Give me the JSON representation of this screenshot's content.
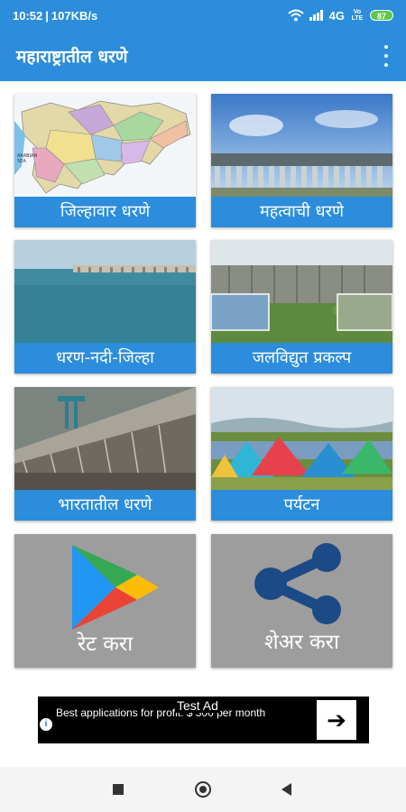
{
  "status_bar": {
    "time": "10:52",
    "speed": "107KB/s",
    "network": "4G",
    "lte": "Vo LTE",
    "battery": "87"
  },
  "app_bar": {
    "title": "महाराष्ट्रातील धरणे",
    "menu_icon": "more-vert-icon"
  },
  "tiles": [
    {
      "label": "जिल्हावार धरणे",
      "image": "maharashtra-map"
    },
    {
      "label": "महत्वाची  धरणे",
      "image": "dam-gates"
    },
    {
      "label": "धरण-नदी-जिल्हा",
      "image": "reservoir-lake"
    },
    {
      "label": "जलविद्युत प्रकल्प",
      "image": "hydro-dam-wall"
    },
    {
      "label": "भारतातील धरणे",
      "image": "india-dam-spillway"
    },
    {
      "label": "पर्यटन",
      "image": "camping-tents"
    }
  ],
  "action_tiles": {
    "rate": {
      "label": "रेट  करा",
      "icon": "play-store-icon"
    },
    "share": {
      "label": "शेअर करा",
      "icon": "share-icon"
    }
  },
  "ad": {
    "badge": "Test Ad",
    "text": "Best applications for profit. $ 300 per month",
    "info_icon": "info-icon",
    "arrow_icon": "arrow-right-icon"
  },
  "nav_bar": {
    "recents_icon": "recents-icon",
    "home_icon": "home-icon",
    "back_icon": "back-icon"
  },
  "colors": {
    "primary": "#2b8ddb",
    "tile_gray": "#9d9d9d",
    "share_icon": "#1c4a85"
  }
}
